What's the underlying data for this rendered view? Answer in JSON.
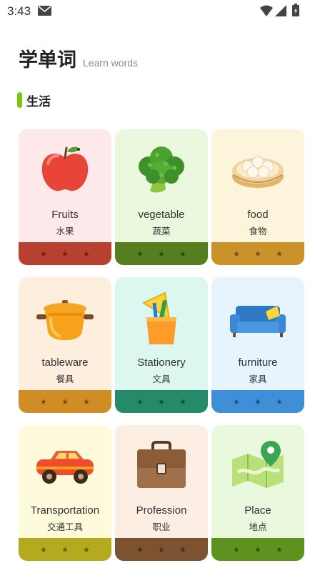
{
  "status_bar": {
    "time": "3:43",
    "icons": [
      "mail-icon",
      "wifi-icon",
      "signal-icon",
      "battery-icon"
    ]
  },
  "header": {
    "title": "学单词",
    "subtitle": "Learn words"
  },
  "section": {
    "title": "生活",
    "accent_color": "#7ac70c"
  },
  "cards": [
    {
      "en": "Fruits",
      "zh": "水果",
      "icon": "apple-icon",
      "bg": "#fde8ea",
      "footer": "#b8402e"
    },
    {
      "en": "vegetable",
      "zh": "蔬菜",
      "icon": "broccoli-icon",
      "bg": "#eaf9de",
      "footer": "#557f1e"
    },
    {
      "en": "food",
      "zh": "食物",
      "icon": "dumplings-icon",
      "bg": "#fdf4dc",
      "footer": "#cb922a"
    },
    {
      "en": "tableware",
      "zh": "餐具",
      "icon": "pot-icon",
      "bg": "#fdeedd",
      "footer": "#d08d24"
    },
    {
      "en": "Stationery",
      "zh": "文具",
      "icon": "pencil-cup-icon",
      "bg": "#dcf6f0",
      "footer": "#248a6a"
    },
    {
      "en": "furniture",
      "zh": "家具",
      "icon": "sofa-icon",
      "bg": "#e7f3fd",
      "footer": "#3f8fd8"
    },
    {
      "en": "Transportation",
      "zh": "交通工具",
      "icon": "car-icon",
      "bg": "#fdfbdc",
      "footer": "#b4aa20"
    },
    {
      "en": "Profession",
      "zh": "职业",
      "icon": "briefcase-icon",
      "bg": "#fdeee4",
      "footer": "#7d5230"
    },
    {
      "en": "Place",
      "zh": "地点",
      "icon": "map-pin-icon",
      "bg": "#eaf9de",
      "footer": "#5e921e"
    }
  ]
}
